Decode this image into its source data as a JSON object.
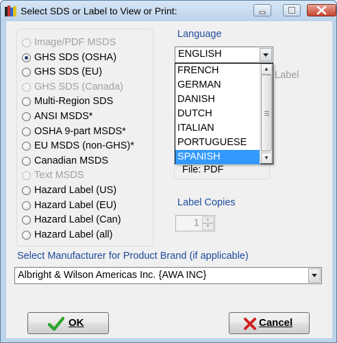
{
  "window": {
    "title": "Select SDS or Label to View or Print:"
  },
  "document_types": [
    {
      "label": "Image/PDF MSDS",
      "enabled": false,
      "selected": false
    },
    {
      "label": "GHS SDS (OSHA)",
      "enabled": true,
      "selected": true
    },
    {
      "label": "GHS SDS (EU)",
      "enabled": true,
      "selected": false
    },
    {
      "label": "GHS SDS (Canada)",
      "enabled": false,
      "selected": false
    },
    {
      "label": "Multi-Region SDS",
      "enabled": true,
      "selected": false
    },
    {
      "label": "ANSI MSDS*",
      "enabled": true,
      "selected": false
    },
    {
      "label": "OSHA 9-part MSDS*",
      "enabled": true,
      "selected": false
    },
    {
      "label": "EU MSDS (non-GHS)*",
      "enabled": true,
      "selected": false
    },
    {
      "label": "Canadian MSDS",
      "enabled": true,
      "selected": false
    },
    {
      "label": "Text MSDS",
      "enabled": false,
      "selected": false
    },
    {
      "label": "Hazard Label (US)",
      "enabled": true,
      "selected": false
    },
    {
      "label": "Hazard Label (EU)",
      "enabled": true,
      "selected": false
    },
    {
      "label": "Hazard Label (Can)",
      "enabled": true,
      "selected": false
    },
    {
      "label": "Hazard Label (all)",
      "enabled": true,
      "selected": false
    }
  ],
  "language": {
    "label": "Language",
    "value": "ENGLISH",
    "options": [
      "FRENCH",
      "GERMAN",
      "DANISH",
      "DUTCH",
      "ITALIAN",
      "PORTUGUESE",
      "SPANISH"
    ],
    "highlighted": "SPANISH"
  },
  "obscured": {
    "label_text": "Label",
    "file_pdf": "File: PDF"
  },
  "label_copies": {
    "label": "Label Copies",
    "value": "1"
  },
  "manufacturer": {
    "label": "Select Manufacturer for Product Brand (if applicable)",
    "value": "Albright & Wilson Americas Inc.  {AWA INC}"
  },
  "buttons": {
    "ok": "OK",
    "cancel": "Cancel"
  },
  "colors": {
    "label_blue": "#1e4a9b",
    "selection": "#3399ff",
    "ok_check": "#2fa52f",
    "cancel_x": "#d42020"
  }
}
